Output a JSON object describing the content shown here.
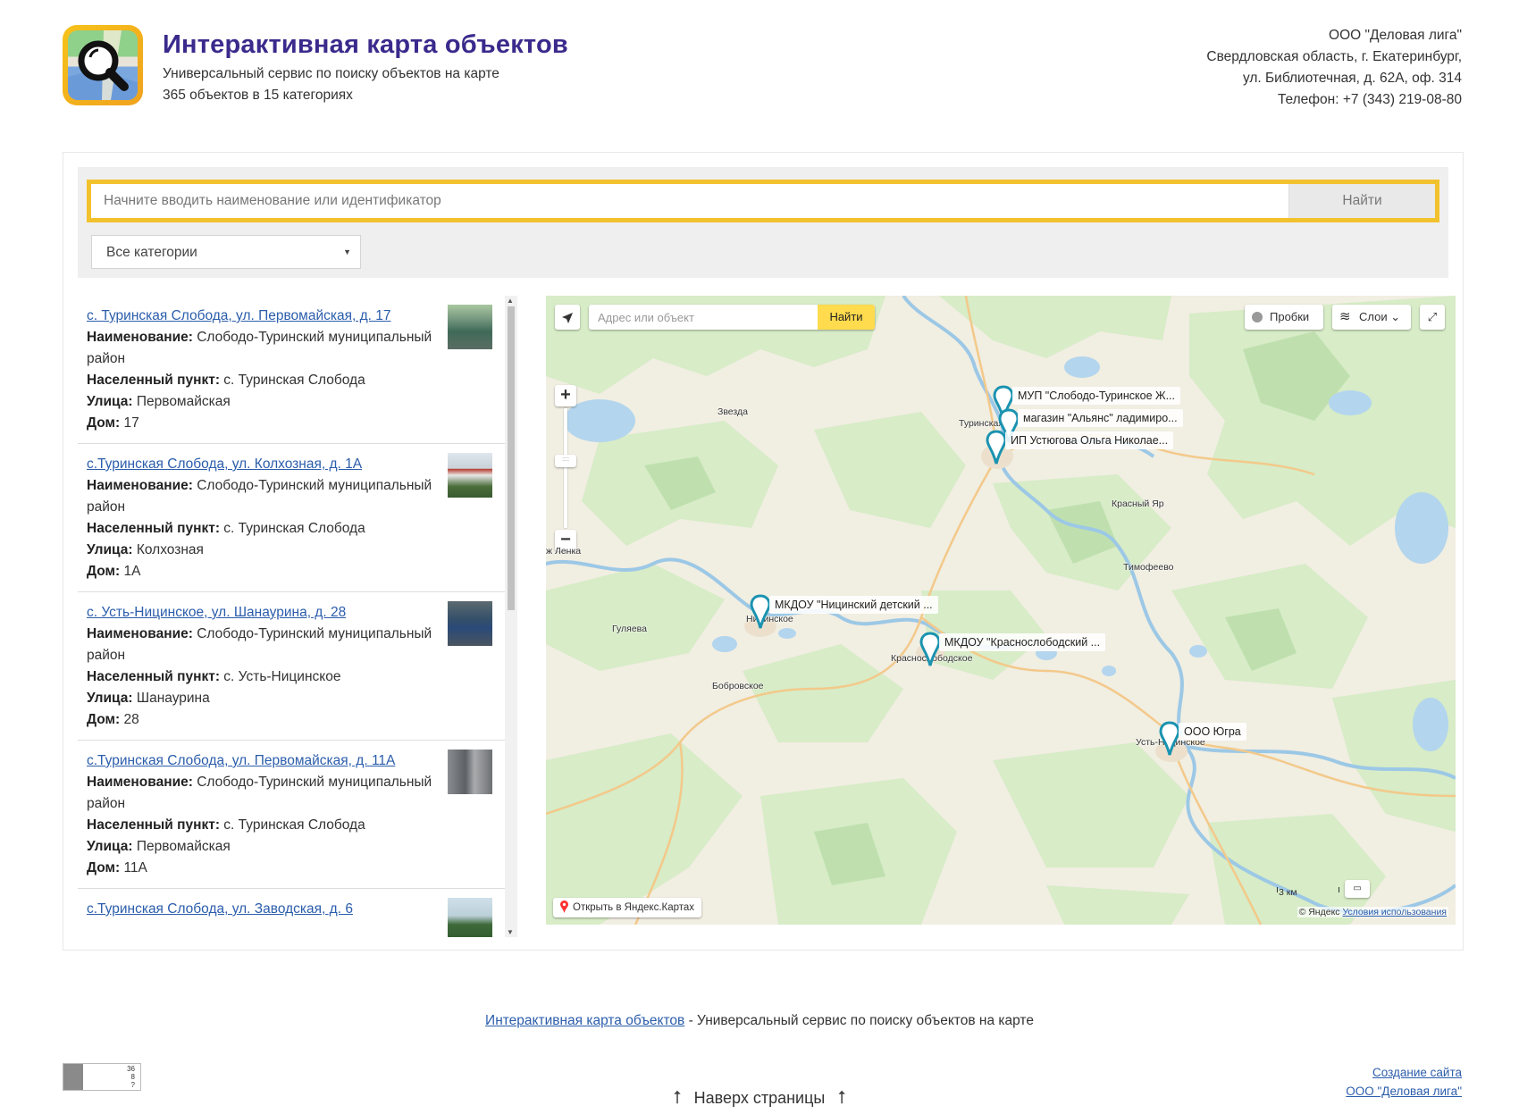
{
  "header": {
    "title": "Интерактивная карта объектов",
    "subtitle": "Универсальный сервис по поиску объектов на карте",
    "count": "365 объектов в 15 категориях"
  },
  "company": {
    "name": "ООО \"Деловая лига\"",
    "region": "Свердловская область, г. Екатеринбург,",
    "address": "ул. Библиотечная, д. 62А, оф. 314",
    "phone": "Телефон: +7 (343) 219-08-80"
  },
  "search": {
    "placeholder": "Начните вводить наименование или идентификатор",
    "button": "Найти",
    "category": "Все категории"
  },
  "list": {
    "labels": {
      "name": "Наименование",
      "settlement": "Населенный пункт",
      "street": "Улица",
      "house": "Дом"
    },
    "items": [
      {
        "link": "с. Туринская Слобода, ул. Первомайская, д. 17",
        "name": "Слободо-Туринский муниципальный район",
        "settlement": "с. Туринская Слобода",
        "street": "Первомайская",
        "house": "17"
      },
      {
        "link": "с.Туринская Слобода, ул. Колхозная, д. 1А",
        "name": "Слободо-Туринский муниципальный район",
        "settlement": "с. Туринская Слобода",
        "street": "Колхозная",
        "house": "1А"
      },
      {
        "link": "с. Усть-Ницинское, ул. Шанаурина, д. 28",
        "name": "Слободо-Туринский муниципальный район",
        "settlement": "с. Усть-Ницинское",
        "street": "Шанаурина",
        "house": "28"
      },
      {
        "link": "с.Туринская Слобода, ул. Первомайская, д. 11А",
        "name": "Слободо-Туринский муниципальный район",
        "settlement": "с. Туринская Слобода",
        "street": "Первомайская",
        "house": "11А"
      },
      {
        "link": "с.Туринская Слобода, ул. Заводская, д. 6"
      }
    ]
  },
  "map": {
    "search_placeholder": "Адрес или объект",
    "search_button": "Найти",
    "traffic": "Пробки",
    "layers": "Слои",
    "open_yandex": "Открыть в Яндекс.Картах",
    "scale": "3 км",
    "copyright": "© Яндекс",
    "terms": "Условия использования",
    "places": {
      "zvezda": "Звезда",
      "turinskaya": "Туринская",
      "krasny_yar": "Красный Яр",
      "timofeevo": "Тимофеево",
      "lenka": "ж   Ленка",
      "nitsinskoe": "Ницинское",
      "gulyaeva": "Гуляева",
      "krasnoslobodskoe": "Краснослободское",
      "bobrovskoe": "Бобровское",
      "ust_nitsinskoe": "Усть-Ницинское"
    },
    "markers": [
      "МУП \"Слободо-Туринское Ж...",
      "магазин \"Альянс\"  ладимиро...",
      "ИП Устюгова Ольга Николае...",
      "МКДОУ \"Ницинский детский ...",
      "МКДОУ \"Краснослободский ...",
      "ООО Югра"
    ]
  },
  "footer": {
    "link": "Интерактивная карта объектов",
    "text": " - Универсальный сервис по поиску объектов на карте",
    "to_top": "Наверх страницы",
    "counter": [
      "36",
      "8",
      "?"
    ],
    "credit1": "Создание сайта",
    "credit2": "ООО \"Деловая лига\""
  }
}
